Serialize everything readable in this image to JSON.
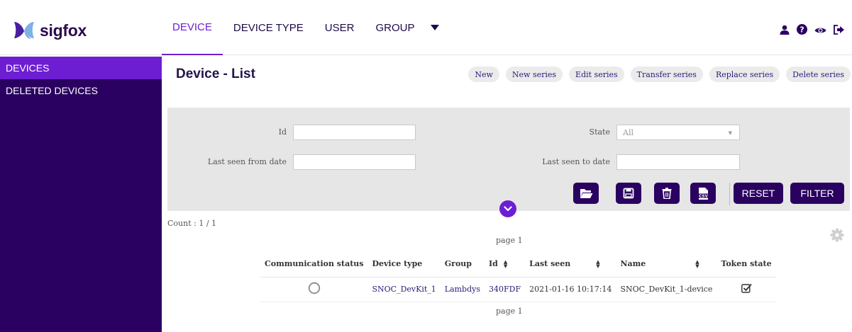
{
  "app": {
    "brand": "sigfox"
  },
  "nav": {
    "items": [
      {
        "label": "DEVICE",
        "active": true
      },
      {
        "label": "DEVICE TYPE",
        "active": false
      },
      {
        "label": "USER",
        "active": false
      },
      {
        "label": "GROUP",
        "active": false
      }
    ]
  },
  "top_icons": [
    "user-icon",
    "help-icon",
    "eye-icon",
    "logout-icon"
  ],
  "sidebar": {
    "items": [
      {
        "label": "DEVICES",
        "active": true
      },
      {
        "label": "DELETED DEVICES",
        "active": false
      }
    ]
  },
  "page": {
    "title": "Device - List"
  },
  "actions": [
    "New",
    "New series",
    "Edit series",
    "Transfer series",
    "Replace series",
    "Delete series"
  ],
  "filters": {
    "id_label": "Id",
    "id_value": "",
    "state_label": "State",
    "state_value": "All",
    "last_seen_from_label": "Last seen from date",
    "last_seen_from_value": "",
    "last_seen_to_label": "Last seen to date",
    "last_seen_to_value": "",
    "reset_label": "RESET",
    "filter_label": "FILTER"
  },
  "results": {
    "count": "Count : 1 / 1",
    "page_top": "page 1",
    "page_bottom": "page 1",
    "columns": [
      "Communication status",
      "Device type",
      "Group",
      "Id",
      "Last seen",
      "Name",
      "Token state"
    ],
    "rows": [
      {
        "device_type": "SNOC_DevKit_1",
        "group": "Lambdys",
        "id": "340FDF",
        "last_seen": "2021-01-16 10:17:14",
        "name": "SNOC_DevKit_1-device"
      }
    ]
  },
  "colors": {
    "primary_dark": "#2a0160",
    "accent": "#6d1ed3",
    "link": "#2e1a78"
  }
}
